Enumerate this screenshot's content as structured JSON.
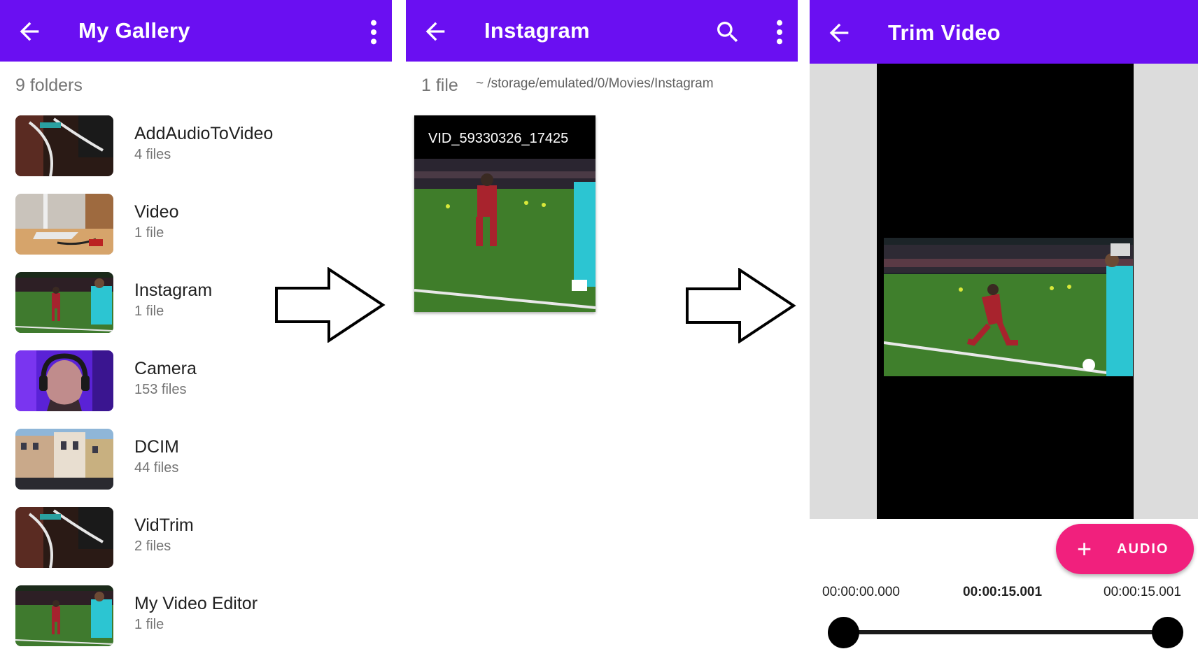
{
  "screen1": {
    "title": "My Gallery",
    "folder_count": "9 folders",
    "folders": [
      {
        "name": "AddAudioToVideo",
        "count": "4 files"
      },
      {
        "name": "Video",
        "count": "1 file"
      },
      {
        "name": "Instagram",
        "count": "1 file"
      },
      {
        "name": "Camera",
        "count": "153 files"
      },
      {
        "name": "DCIM",
        "count": "44 files"
      },
      {
        "name": "VidTrim",
        "count": "2 files"
      },
      {
        "name": "My Video Editor",
        "count": "1 file"
      }
    ]
  },
  "screen2": {
    "title": "Instagram",
    "file_count": "1 file",
    "path": "~ /storage/emulated/0/Movies/Instagram",
    "video_name": "VID_59330326_17425"
  },
  "screen3": {
    "title": "Trim Video",
    "fab_label": "AUDIO",
    "time_start": "00:00:00.000",
    "time_current": "00:00:15.001",
    "time_end": "00:00:15.001"
  },
  "colors": {
    "appbar": "#6a0ff2",
    "fab": "#f1207d"
  },
  "icons": [
    "back-arrow-icon",
    "more-vert-icon",
    "search-icon",
    "plus-icon",
    "flow-arrow-icon"
  ]
}
